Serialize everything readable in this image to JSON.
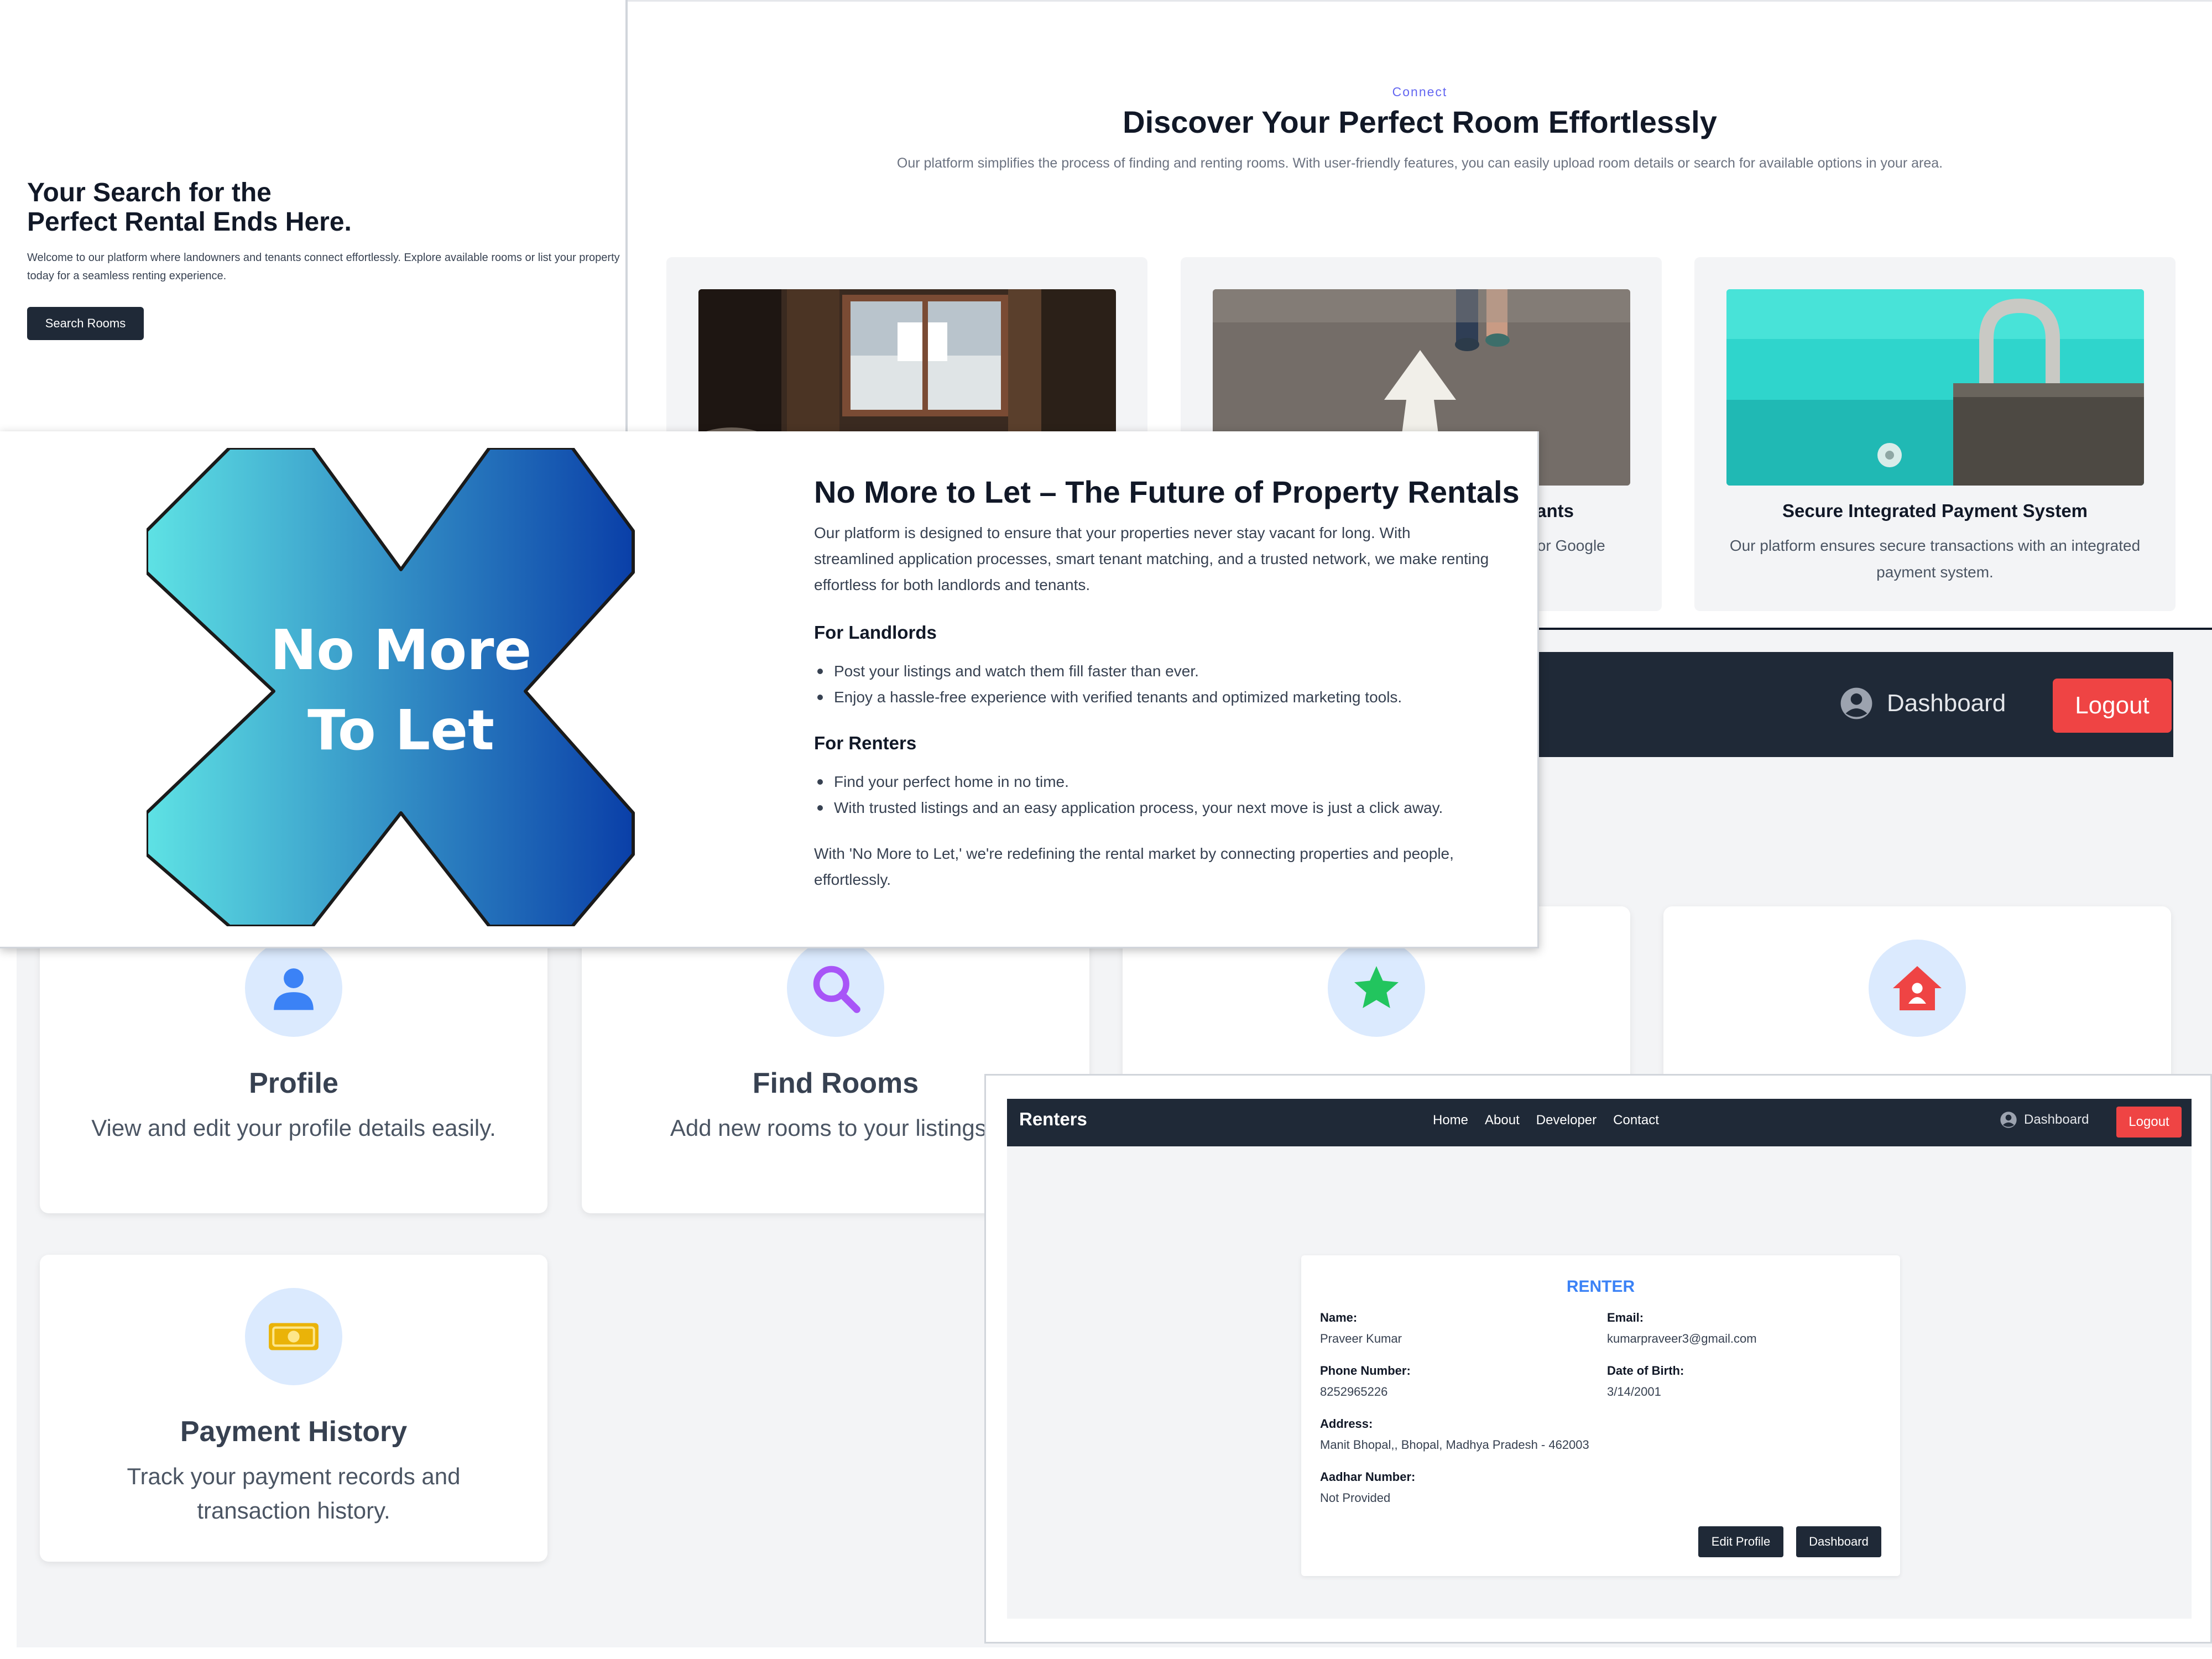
{
  "hero": {
    "title_line1": "Your Search for the",
    "title_line2": "Perfect Rental Ends Here.",
    "description_line1": "Welcome to our platform where landowners and tenants connect effortlessly. Explore available rooms or list your property",
    "description_line2": "today for a seamless renting experience.",
    "button_label": "Search Rooms"
  },
  "features": {
    "eyebrow": "Connect",
    "title": "Discover Your Perfect Room Effortlessly",
    "subtitle": "Our platform simplifies the process of finding and renting rooms. With user-friendly features, you can easily upload room details or search for available options in your area.",
    "cards": [
      {
        "title": "",
        "desc": ""
      },
      {
        "title": "nants",
        "desc": "s or Google"
      },
      {
        "title": "Secure Integrated Payment System",
        "desc": "Our platform ensures secure transactions with an integrated payment system."
      }
    ]
  },
  "about": {
    "logo_text_line1": "No More",
    "logo_text_line2": "To Let",
    "title": "No More to Let – The Future of Property Rentals",
    "intro": "Our platform is designed to ensure that your properties never stay vacant for long. With streamlined application processes, smart tenant matching, and a trusted network, we make renting effortless for both landlords and tenants.",
    "landlords_heading": "For Landlords",
    "landlords_items": [
      "Post your listings and watch them fill faster than ever.",
      "Enjoy a hassle-free experience with verified tenants and optimized marketing tools."
    ],
    "renters_heading": "For Renters",
    "renters_items": [
      "Find your perfect home in no time.",
      "With trusted listings and an easy application process, your next move is just a click away."
    ],
    "closing": "With 'No More to Let,' we're redefining the rental market by connecting properties and people, effortlessly."
  },
  "dashboard": {
    "nav_dashboard": "Dashboard",
    "nav_logout": "Logout",
    "cards": [
      {
        "title": "Profile",
        "desc": "View and edit your profile details easily."
      },
      {
        "title": "Find Rooms",
        "desc": "Add new rooms to your listings with"
      },
      {
        "title": "Payment History",
        "desc": "Track your payment records and transaction history."
      }
    ]
  },
  "renter": {
    "brand": "Renters",
    "nav_links": [
      "Home",
      "About",
      "Developer",
      "Contact"
    ],
    "nav_dashboard": "Dashboard",
    "nav_logout": "Logout",
    "card_title": "RENTER",
    "name_label": "Name:",
    "name": "Praveer Kumar",
    "email_label": "Email:",
    "email": "kumarpraveer3@gmail.com",
    "phone_label": "Phone Number:",
    "phone": "8252965226",
    "dob_label": "Date of Birth:",
    "dob": "3/14/2001",
    "address_label": "Address:",
    "address": "Manit Bhopal,, Bhopal, Madhya Pradesh - 462003",
    "aadhar_label": "Aadhar Number:",
    "aadhar": "Not Provided",
    "edit_button": "Edit Profile",
    "dashboard_button": "Dashboard"
  },
  "colors": {
    "dark_nav": "#1f2937",
    "logout_red": "#ef4444",
    "accent_blue": "#3b82f6",
    "eyebrow_indigo": "#6366f1",
    "logo_gradient_start": "#5ee2e4",
    "logo_gradient_end": "#0a3fa8"
  }
}
